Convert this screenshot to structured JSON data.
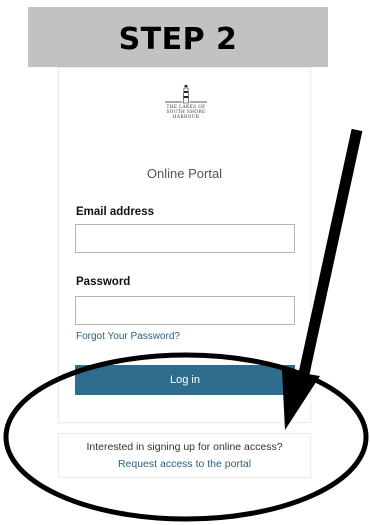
{
  "banner": {
    "text": "STEP 2"
  },
  "logo": {
    "icon": "lighthouse-icon",
    "lines": [
      "THE LAKES OF",
      "SOUTH SHORE",
      "HARBOUR"
    ]
  },
  "portal": {
    "title": "Online Portal"
  },
  "form": {
    "email_label": "Email address",
    "email_value": "",
    "password_label": "Password",
    "password_value": "",
    "forgot_link": "Forgot Your Password?",
    "login_label": "Log in"
  },
  "signup": {
    "text": "Interested in signing up for online access?",
    "link": "Request access to the portal"
  },
  "colors": {
    "banner_bg": "#c2c2c2",
    "button_bg": "#2f6d8e",
    "link": "#2b5f83",
    "annotation": "#000000"
  }
}
